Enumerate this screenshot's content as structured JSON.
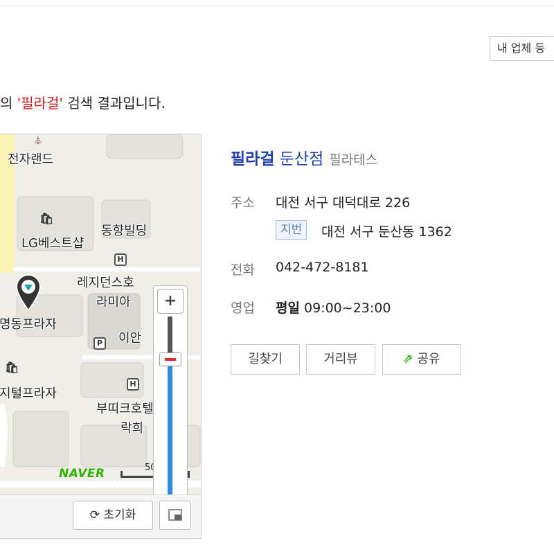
{
  "header": {
    "biz_button_label": "내 업체 등"
  },
  "result": {
    "prefix": "의 ",
    "keyword": "'필라걸'",
    "suffix": " 검색 결과입니다."
  },
  "map": {
    "labels": {
      "electronics_land": "전자랜드",
      "lg_shop": "LG베스트샵",
      "donghyang": "동향빌딩",
      "residence": "레지던스호",
      "ramia": "라미아",
      "plaza_left": "명동프라자",
      "iand": "이안",
      "digital_plaza": "지털프라자",
      "boutique": "부띠크호텔",
      "rakhee": "락희"
    },
    "poi": {
      "hotel": "H",
      "parking": "P"
    },
    "zoom_in": "+",
    "zoom_out": "−",
    "zoom_level": 0.2,
    "logo": "NAVER",
    "scale": "50m",
    "reset_label": "초기화"
  },
  "place": {
    "name": "필라걸",
    "branch": "둔산점",
    "category": "필라테스",
    "address_label": "주소",
    "address": "대전 서구 대덕대로 226",
    "jibun_label": "지번",
    "jibun_address": "대전 서구 둔산동 1362",
    "phone_label": "전화",
    "phone": "042-472-8181",
    "hours_label": "영업",
    "hours_day": "평일",
    "hours_time": "09:00~23:00"
  },
  "actions": {
    "directions": "길찾기",
    "street_view": "거리뷰",
    "share": "공유"
  },
  "colors": {
    "link_blue": "#1f3fb5",
    "keyword_red": "#e0141a",
    "naver_green": "#2db400",
    "zoom_blue": "#2a8ae8"
  }
}
